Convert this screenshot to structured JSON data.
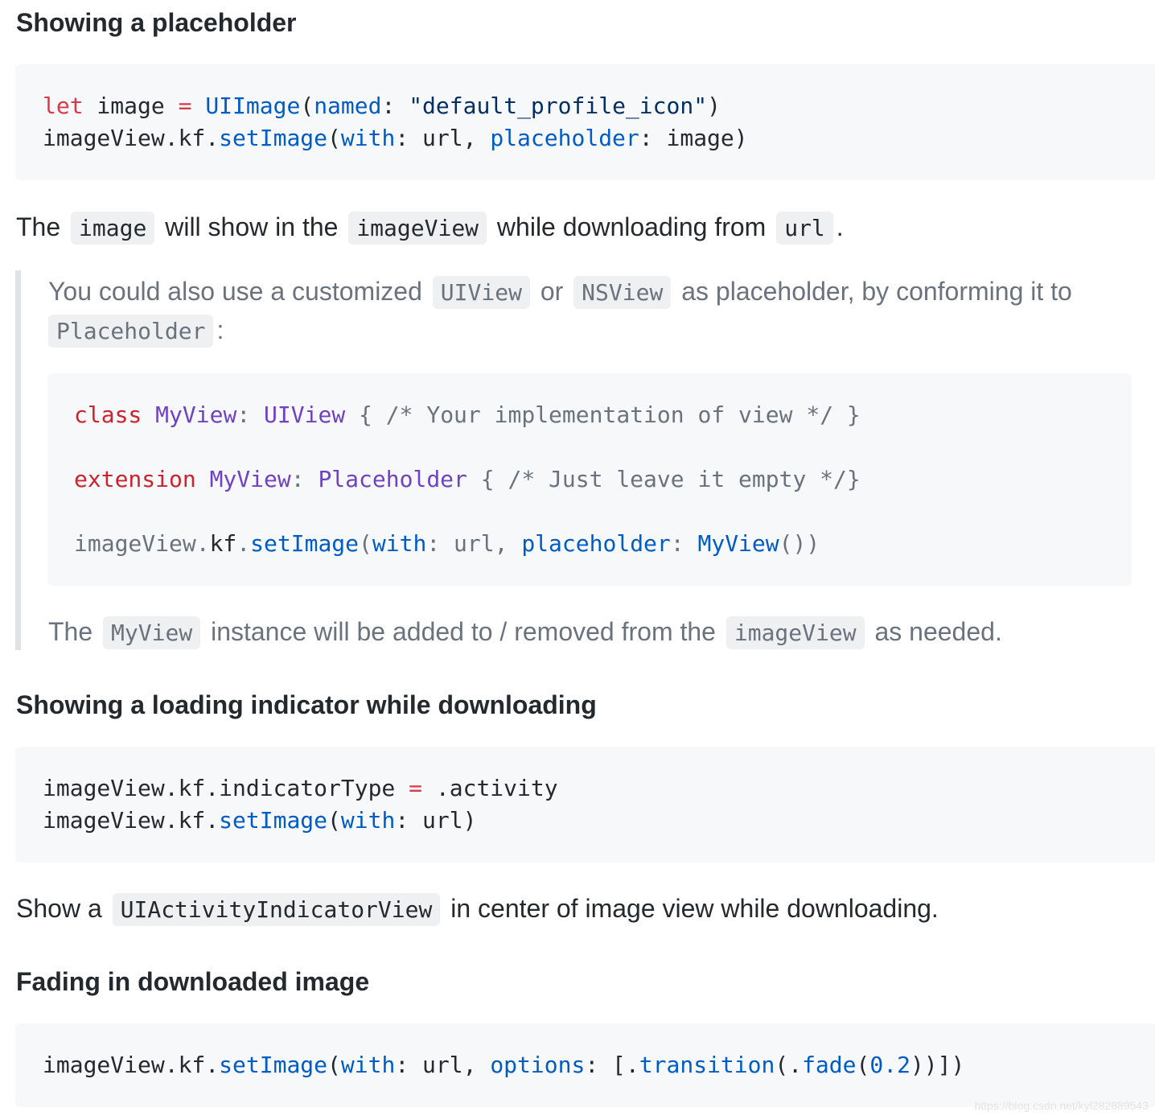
{
  "sections": {
    "placeholder": {
      "heading": "Showing a placeholder",
      "code_line1": {
        "let": "let",
        "rest1": " image ",
        "eq": "=",
        "space": " ",
        "type": "UIImage",
        "open": "(",
        "named": "named",
        "colon": ": ",
        "str": "\"default_profile_icon\"",
        "close": ")"
      },
      "code_line2": {
        "prefix": "imageView.kf.",
        "fn": "setImage",
        "open": "(",
        "with": "with",
        "mid": ": url, ",
        "placeholder": "placeholder",
        "end": ": image)"
      },
      "desc": {
        "t1": "The",
        "c1": "image",
        "t2": "will show in the",
        "c2": "imageView",
        "t3": "while downloading from",
        "c3": "url",
        "t4": "."
      }
    },
    "quote": {
      "line1": {
        "t1": "You could also use a customized",
        "c1": "UIView",
        "t2": "or",
        "c2": "NSView",
        "t3": "as placeholder, by conforming it to"
      },
      "line2": {
        "c1": "Placeholder",
        "t1": ":"
      },
      "code1": {
        "kw": "class",
        "name": "MyView",
        "colon": ": ",
        "type": "UIView",
        "rest": " { /* Your implementation of view */ }"
      },
      "code2": {
        "kw": "extension",
        "name": "MyView",
        "colon": ": ",
        "type": "Placeholder",
        "rest": " { /* Just leave it empty */}"
      },
      "code3": {
        "prefix": "imageView.",
        "kf": "kf",
        "dot": ".",
        "fn": "setImage",
        "open": "(",
        "with": "with",
        "mid": ": url, ",
        "placeholder": "placeholder",
        "colon": ": ",
        "myview": "MyView",
        "end": "())"
      },
      "after": {
        "t1": "The",
        "c1": "MyView",
        "t2": "instance will be added to / removed from the",
        "c2": "imageView",
        "t3": "as needed."
      }
    },
    "indicator": {
      "heading": "Showing a loading indicator while downloading",
      "code_line1": {
        "prefix": "imageView.kf.indicatorType ",
        "eq": "=",
        "rest": " .activity"
      },
      "code_line2": {
        "prefix": "imageView.kf.",
        "fn": "setImage",
        "open": "(",
        "with": "with",
        "end": ": url)"
      },
      "desc": {
        "t1": "Show a",
        "c1": "UIActivityIndicatorView",
        "t2": "in center of image view while downloading."
      }
    },
    "fading": {
      "heading": "Fading in downloaded image",
      "code_line1": {
        "prefix": "imageView.kf.",
        "fn": "setImage",
        "open": "(",
        "with": "with",
        "mid": ": url, ",
        "options": "options",
        "colon": ": [.",
        "transition": "transition",
        "p1": "(.",
        "fade": "fade",
        "p2": "(",
        "num": "0.2",
        "end": "))])"
      }
    }
  },
  "watermark": "https://blog.csdn.net/kyl282889543"
}
